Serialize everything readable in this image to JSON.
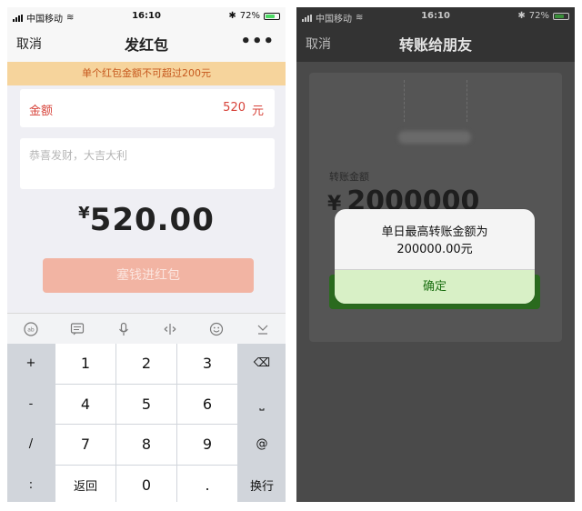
{
  "left": {
    "status": {
      "carrier": "中国移动",
      "time": "16:10",
      "battery": "72%"
    },
    "nav": {
      "cancel": "取消",
      "title": "发红包",
      "more": "•••"
    },
    "warning": "单个红包金额不可超过200元",
    "amount": {
      "label": "金额",
      "value": "520",
      "unit": "元"
    },
    "greeting_placeholder": "恭喜发财，大吉大利",
    "total": {
      "currency": "¥",
      "value": "520.00"
    },
    "send_button": "塞钱进红包",
    "keyboard": {
      "keys": [
        {
          "label": "+",
          "side": true
        },
        {
          "label": "1"
        },
        {
          "label": "2"
        },
        {
          "label": "3"
        },
        {
          "label": "⌫",
          "side": true,
          "name": "backspace-key"
        },
        {
          "label": "-",
          "side": true
        },
        {
          "label": "4"
        },
        {
          "label": "5"
        },
        {
          "label": "6"
        },
        {
          "label": "⎵",
          "side": true,
          "name": "space-key"
        },
        {
          "label": "/",
          "side": true
        },
        {
          "label": "7"
        },
        {
          "label": "8"
        },
        {
          "label": "9"
        },
        {
          "label": "@",
          "side": true
        },
        {
          "label": ":",
          "side": true
        },
        {
          "label": "返回",
          "small": true
        },
        {
          "label": "0"
        },
        {
          "label": "."
        },
        {
          "label": "换行",
          "side": true
        }
      ]
    }
  },
  "right": {
    "status": {
      "carrier": "中国移动",
      "time": "16:10",
      "battery": "72%"
    },
    "nav": {
      "cancel": "取消",
      "title": "转账给朋友"
    },
    "transfer_label": "转账金额",
    "transfer_amount": {
      "currency": "¥",
      "value": "2000000"
    },
    "alert": {
      "message_line1": "单日最高转账金额为",
      "message_line2": "200000.00元",
      "confirm": "确定"
    }
  },
  "colors": {
    "red": "#d7433a",
    "warning_bg": "#f6d49c",
    "green": "#1c6f12"
  }
}
